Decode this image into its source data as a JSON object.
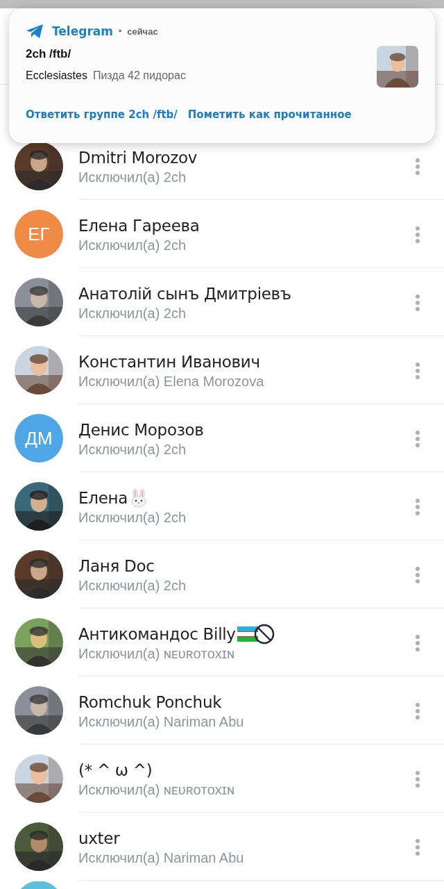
{
  "notification": {
    "app": "Telegram",
    "separator": "•",
    "time": "сейчас",
    "title": "2ch /ftb/",
    "sender": "Ecclesiastes",
    "message": "Пизда 42 пидорас",
    "thumbnail": {
      "kind": "picture"
    },
    "actions": [
      "Ответить группе 2ch /ftb/",
      "Пометить как прочитанное"
    ]
  },
  "members": [
    {
      "name": "Dmitri Morozov",
      "subtitle": "Исключил(а) 2ch",
      "avatar": {
        "kind": "picture"
      }
    },
    {
      "name": "Елена Гареева",
      "subtitle": "Исключил(а) 2ch",
      "avatar": {
        "kind": "initials",
        "initials": "ЕГ",
        "color": "#f08a47"
      }
    },
    {
      "name": "Анатолій сынъ Дмитріевъ",
      "subtitle": "Исключил(а) 2ch",
      "avatar": {
        "kind": "picture"
      }
    },
    {
      "name": "Константин Иванович",
      "subtitle": "Исключил(а) Elena Morozova",
      "avatar": {
        "kind": "picture"
      }
    },
    {
      "name": "Денис Морозов",
      "subtitle": "Исключил(а) 2ch",
      "avatar": {
        "kind": "initials",
        "initials": "ДМ",
        "color": "#4fa6e6"
      }
    },
    {
      "name": "Елена",
      "emoji": [
        {
          "kind": "rabbit"
        }
      ],
      "subtitle": "Исключил(а) 2ch",
      "avatar": {
        "kind": "picture"
      }
    },
    {
      "name": "Ланя Doc",
      "subtitle": "Исключил(а) 2ch",
      "avatar": {
        "kind": "picture"
      }
    },
    {
      "name": "Антикомандос Billy",
      "emoji": [
        {
          "kind": "flag"
        },
        {
          "kind": "prohibited"
        }
      ],
      "subtitle": "Исключил(а) ɴᴇᴜʀᴏᴛᴏxɪɴ",
      "avatar": {
        "kind": "picture"
      }
    },
    {
      "name": "Romchuk Ponchuk",
      "subtitle": "Исключил(а) Nariman Abu",
      "avatar": {
        "kind": "picture"
      }
    },
    {
      "name": "(* ^ ω ^)",
      "subtitle": "Исключил(а) ɴᴇᴜʀᴏᴛᴏxɪɴ",
      "avatar": {
        "kind": "picture"
      }
    },
    {
      "name": "uxter",
      "subtitle": "Исключил(а) Nariman Abu",
      "avatar": {
        "kind": "picture"
      }
    }
  ]
}
